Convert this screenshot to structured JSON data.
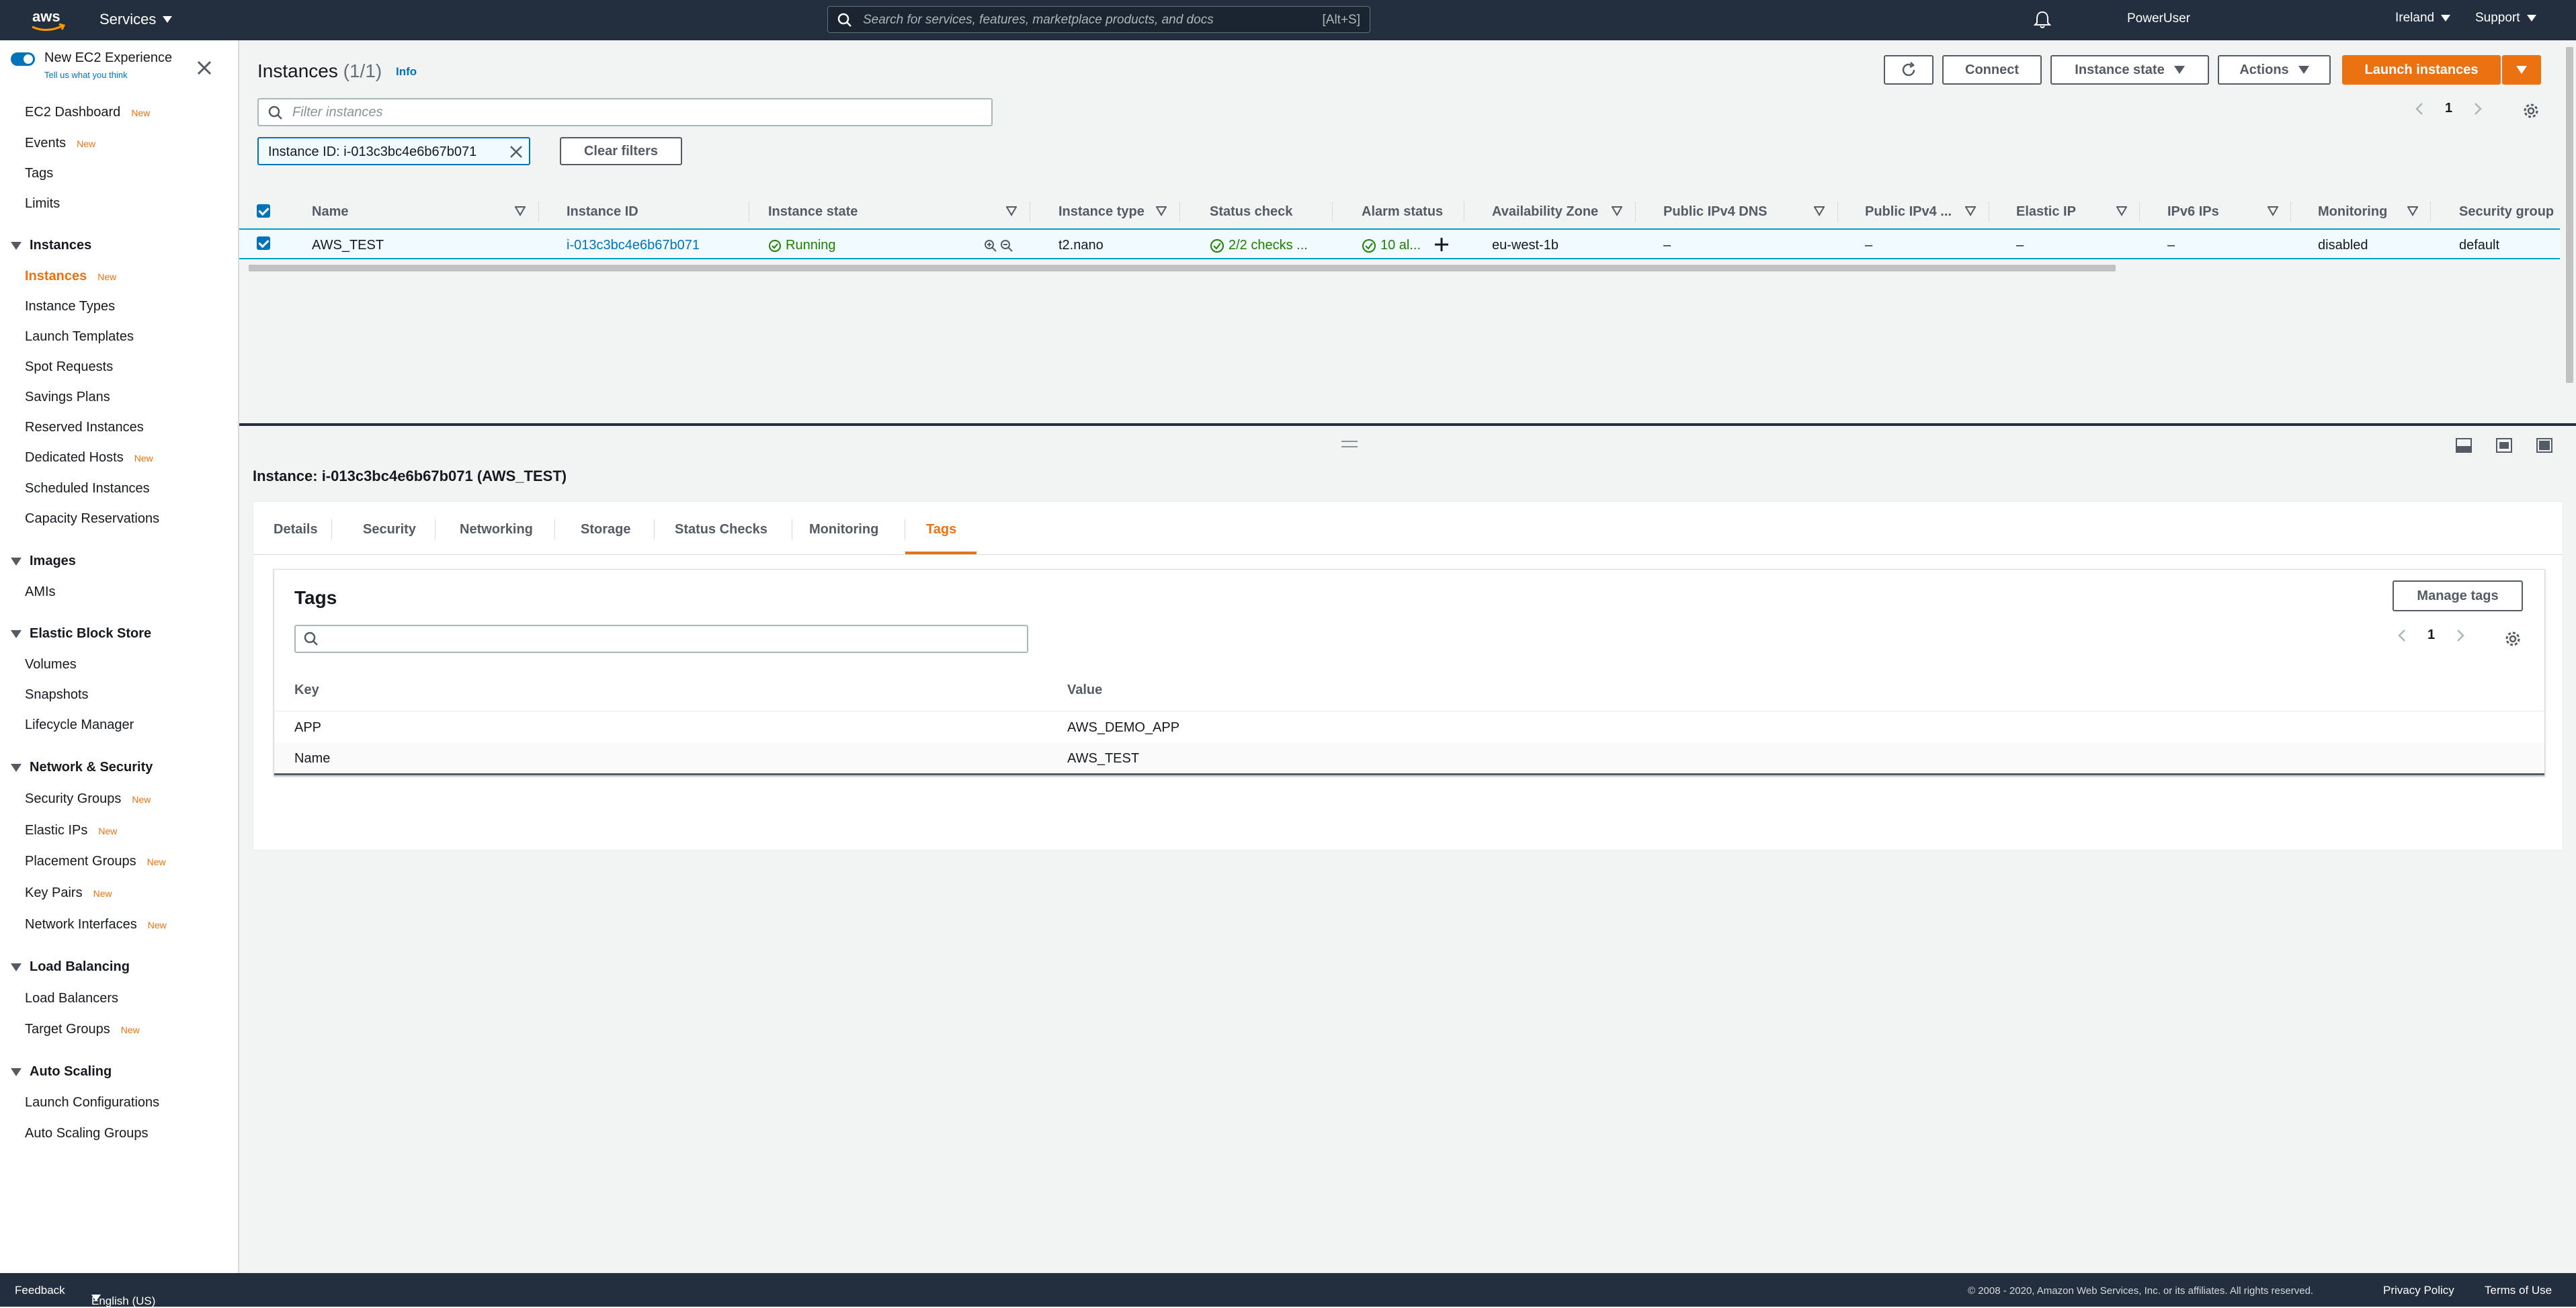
{
  "topnav": {
    "services_label": "Services",
    "search_placeholder": "Search for services, features, marketplace products, and docs",
    "search_shortcut": "[Alt+S]",
    "user": "PowerUser",
    "region": "Ireland",
    "support": "Support"
  },
  "sidebar": {
    "new_experience": "New EC2 Experience",
    "tell_us": "Tell us what you think",
    "new_badge": "New",
    "top_links": [
      {
        "label": "EC2 Dashboard",
        "new": true
      },
      {
        "label": "Events",
        "new": true
      },
      {
        "label": "Tags",
        "new": false
      },
      {
        "label": "Limits",
        "new": false
      }
    ],
    "sections": {
      "instances": {
        "title": "Instances",
        "items": [
          {
            "label": "Instances",
            "new": true,
            "active": true
          },
          {
            "label": "Instance Types"
          },
          {
            "label": "Launch Templates"
          },
          {
            "label": "Spot Requests"
          },
          {
            "label": "Savings Plans"
          },
          {
            "label": "Reserved Instances"
          },
          {
            "label": "Dedicated Hosts",
            "new": true
          },
          {
            "label": "Scheduled Instances"
          },
          {
            "label": "Capacity Reservations"
          }
        ]
      },
      "images": {
        "title": "Images",
        "items": [
          {
            "label": "AMIs"
          }
        ]
      },
      "ebs": {
        "title": "Elastic Block Store",
        "items": [
          {
            "label": "Volumes"
          },
          {
            "label": "Snapshots"
          },
          {
            "label": "Lifecycle Manager"
          }
        ]
      },
      "network": {
        "title": "Network & Security",
        "items": [
          {
            "label": "Security Groups",
            "new": true
          },
          {
            "label": "Elastic IPs",
            "new": true
          },
          {
            "label": "Placement Groups",
            "new": true
          },
          {
            "label": "Key Pairs",
            "new": true
          },
          {
            "label": "Network Interfaces",
            "new": true
          }
        ]
      },
      "lb": {
        "title": "Load Balancing",
        "items": [
          {
            "label": "Load Balancers"
          },
          {
            "label": "Target Groups",
            "new": true
          }
        ]
      },
      "as": {
        "title": "Auto Scaling",
        "items": [
          {
            "label": "Launch Configurations"
          },
          {
            "label": "Auto Scaling Groups"
          }
        ]
      }
    }
  },
  "main": {
    "title": "Instances",
    "count": "(1/1)",
    "info": "Info",
    "buttons": {
      "connect": "Connect",
      "instance_state": "Instance state",
      "actions": "Actions",
      "launch": "Launch instances"
    },
    "filter_placeholder": "Filter instances",
    "page": "1",
    "token": "Instance ID: i-013c3bc4e6b67b071",
    "clear_filters": "Clear filters",
    "columns": [
      "Name",
      "Instance ID",
      "Instance state",
      "Instance type",
      "Status check",
      "Alarm status",
      "Availability Zone",
      "Public IPv4 DNS",
      "Public IPv4 ...",
      "Elastic IP",
      "IPv6 IPs",
      "Monitoring",
      "Security group"
    ],
    "row": {
      "name": "AWS_TEST",
      "instance_id": "i-013c3bc4e6b67b071",
      "state": "Running",
      "type": "t2.nano",
      "status_check": "2/2 checks ...",
      "alarm": "10 al...",
      "az": "eu-west-1b",
      "dns": "–",
      "ipv4": "–",
      "eip": "–",
      "ipv6": "–",
      "monitoring": "disabled",
      "sg": "default"
    }
  },
  "detail": {
    "title": "Instance: i-013c3bc4e6b67b071 (AWS_TEST)",
    "tabs": [
      "Details",
      "Security",
      "Networking",
      "Storage",
      "Status Checks",
      "Monitoring",
      "Tags"
    ],
    "active_tab": "Tags",
    "tags": {
      "title": "Tags",
      "manage": "Manage tags",
      "page": "1",
      "key_header": "Key",
      "value_header": "Value",
      "rows": [
        {
          "key": "APP",
          "value": "AWS_DEMO_APP"
        },
        {
          "key": "Name",
          "value": "AWS_TEST"
        }
      ]
    }
  },
  "footer": {
    "feedback": "Feedback",
    "language": "English (US)",
    "copyright": "© 2008 - 2020, Amazon Web Services, Inc. or its affiliates. All rights reserved.",
    "privacy": "Privacy Policy",
    "terms": "Terms of Use"
  },
  "colors": {
    "nav_bg": "#232f3e",
    "accent": "#ec7211",
    "link": "#0073bb",
    "success": "#1d8102"
  }
}
